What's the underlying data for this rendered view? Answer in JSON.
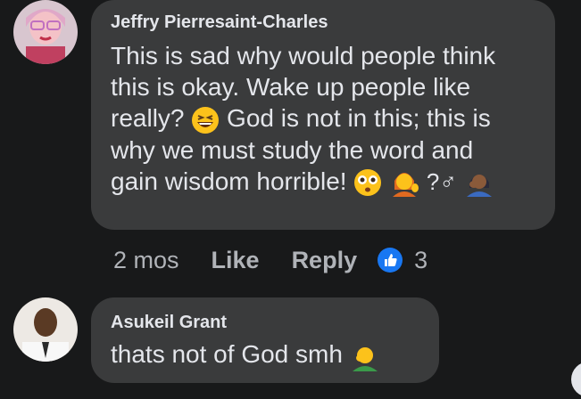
{
  "comments": [
    {
      "author": "Jeffry Pierresaint-Charles",
      "lines": [
        "This is sad why would people think",
        "this is okay. Wake up people like",
        "really?",
        "God is not in this; this is",
        "why we must study the word and",
        "gain wisdom horrible!"
      ],
      "unknown_glyph": "?♂",
      "actions": {
        "time": "2 mos",
        "like": "Like",
        "reply": "Reply",
        "reaction_count": "3"
      },
      "icons": [
        "grinning-squint-emoji",
        "flushed-face-emoji",
        "woman-tipping-hand-emoji",
        "person-facepalming-emoji",
        "like-reaction-icon"
      ]
    },
    {
      "author": "Asukeil Grant",
      "text": "thats not of God smh",
      "icons": [
        "man-facepalming-emoji"
      ]
    }
  ],
  "colors": {
    "background": "#18191a",
    "bubble": "#3a3b3c",
    "text": "#e4e6eb",
    "muted": "#b0b3b8",
    "like_blue": "#1877f2"
  }
}
